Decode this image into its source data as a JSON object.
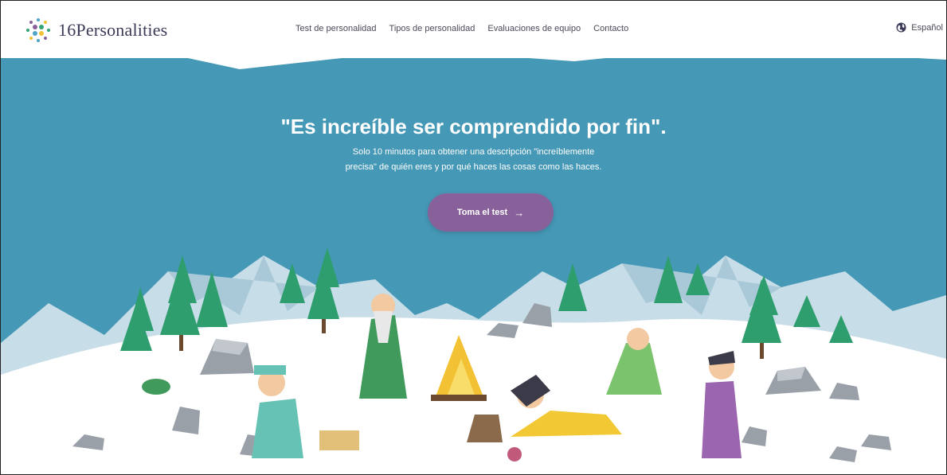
{
  "brand": {
    "logo_icon": "dots-circle-icon",
    "name": "16Personalities"
  },
  "nav": {
    "items": [
      {
        "label": "Test de personalidad"
      },
      {
        "label": "Tipos de personalidad"
      },
      {
        "label": "Evaluaciones de equipo"
      },
      {
        "label": "Contacto"
      }
    ],
    "language": {
      "icon": "globe-icon",
      "label": "Español"
    }
  },
  "hero": {
    "headline": "\"Es increíble ser comprendido por fin\".",
    "subtext_line1": "Solo 10 minutos para obtener una descripción \"increíblemente",
    "subtext_line2": "precisa\" de quién eres y por qué haces las cosas como las haces.",
    "cta_label": "Toma el test",
    "cta_icon": "arrow-right-icon"
  },
  "colors": {
    "sky": "#4598b6",
    "cta": "#88619a",
    "snow": "#ffffff",
    "tree": "#2f9e6e",
    "mountain": "#c9dde6",
    "rock": "#9aa0a8"
  }
}
